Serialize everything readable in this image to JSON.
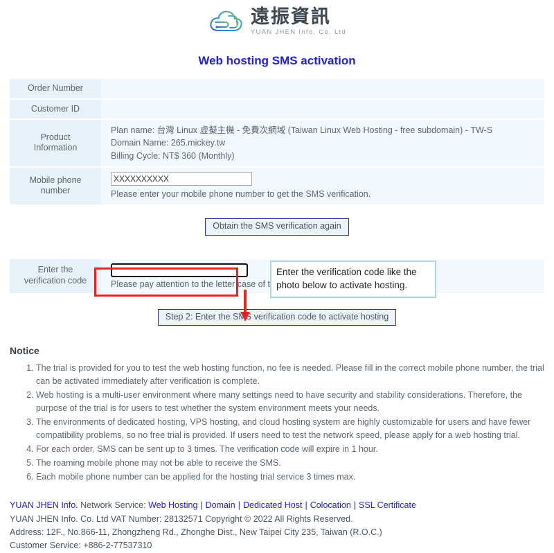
{
  "brand": {
    "logo_icon": "cloud-circuit-icon",
    "name_cn": "遠振資訊",
    "name_en": "YUAN JHEN Info. Co. Ltd"
  },
  "page": {
    "title": "Web hosting SMS activation"
  },
  "order_table": {
    "rows": [
      {
        "label": "Order Number",
        "value": ""
      },
      {
        "label": "Customer ID",
        "value": ""
      }
    ],
    "product": {
      "label": "Product Information",
      "label_line1": "Product",
      "label_line2": "Information",
      "line1": "Plan name: 台灣 Linux 虛擬主機 - 免費次網域 (Taiwan Linux Web Hosting - free subdomain) - TW-S",
      "line2": "Domain Name: 265.mickey.tw",
      "line3": "Billing Cycle: NT$ 360 (Monthly)"
    },
    "mobile": {
      "label_line1": "Mobile phone",
      "label_line2": "number",
      "input_value": "XXXXXXXXXX",
      "input_placeholder": "",
      "hint": "Please enter your mobile phone number to get the SMS verification."
    }
  },
  "buttons": {
    "obtain_sms": "Obtain the SMS verification again",
    "step2": "Step 2: Enter the SMS verification code to activate hosting"
  },
  "verification": {
    "label_line1": "Enter the",
    "label_line2": "verification code",
    "input_value": "",
    "input_placeholder": "",
    "hint": "Please pay attention to the letter case of the verification code.",
    "callout_line1": "Enter the verification code like the",
    "callout_line2": "photo below to activate hosting.",
    "highlight_color": "#e8241f",
    "callout_border_color": "#a8d7e0",
    "arrow_color": "#e8241f"
  },
  "notice": {
    "heading": "Notice",
    "items": [
      "The trial is provided for you to test the web hosting function, no fee is needed. Please fill in the correct mobile phone number, the trial can be activated immediately after verification is complete.",
      "Web hosting is a multi-user environment where many settings need to have security and stability considerations. Therefore, the purpose of the trial is for users to test whether the system environment meets your needs.",
      "The environments of dedicated hosting, VPS hosting, and cloud hosting system are highly customizable for users and have fewer compatibility problems, so no free trial is provided. If users need to test the network speed, please apply for a web hosting trial.",
      "For each order, SMS can be sent up to 3 times. The verification code will expire in 1 hour.",
      "The roaming mobile phone may not be able to receive the SMS.",
      "Each mobile phone number can be applied for the hosting trial service 3 times max."
    ]
  },
  "footer": {
    "brand": "YUAN JHEN Info.",
    "network_service_label": " Network Service: ",
    "links": [
      "Web Hosting",
      "Domain",
      "Dedicated Host",
      "Colocation",
      "SSL Certificate"
    ],
    "separator": "|",
    "line2": "YUAN JHEN Info. Co. Ltd  VAT Number: 28132571  Copyright © 2022 All Rights Reserved.",
    "line3": "Address: 12F., No.866-11, Zhongzheng Rd., Zhonghe Dist., New Taipei City 235, Taiwan (R.O.C.)",
    "line4": "Customer Service: +886-2-77537310",
    "link_color": "#2121d6"
  }
}
